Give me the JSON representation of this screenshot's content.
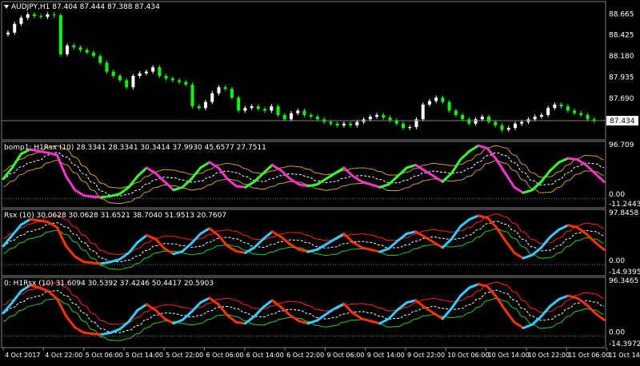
{
  "window": {
    "title": "AUDJPY,H1",
    "ohlc": "87.404 87.444 87.388 87.434"
  },
  "panels": [
    {
      "id": "price",
      "label": "",
      "axis_labels": [
        "88.665",
        "88.425",
        "88.180",
        "87.935",
        "87.690",
        "87.434"
      ],
      "current_price": "87.434"
    },
    {
      "id": "bomp",
      "label": "bomp1: H1Rsx (10) 28.3341 28.3341 30.3414 37.9930 45.6577 27.7511",
      "axis_labels": [
        "96.709",
        "0.00",
        "-11.2443"
      ]
    },
    {
      "id": "rsx",
      "label": "Rsx (10) 30.0628 30.0628 31.6521 38.7040 51.9513 20.7607",
      "axis_labels": [
        "97.8458",
        "0.00",
        "-14.9395"
      ]
    },
    {
      "id": "h1rsx",
      "label": "0: H1Rsx (10) 31.6094 30.5392 37.4246 50.4417 20.5903",
      "axis_labels": [
        "96.3465",
        "0.00",
        "-14.3972"
      ]
    }
  ],
  "time_axis": [
    "4 Oct 2017",
    "4 Oct 22:00",
    "5 Oct 06:00",
    "5 Oct 14:00",
    "5 Oct 22:00",
    "6 Oct 06:00",
    "6 Oct 14:00",
    "6 Oct 22:00",
    "9 Oct 06:00",
    "9 Oct 14:00",
    "9 Oct 22:00",
    "10 Oct 06:00",
    "10 Oct 14:00",
    "10 Oct 22:00",
    "11 Oct 06:00",
    "11 Oct 14:00"
  ],
  "colors": {
    "background": "#000000",
    "grid": "#7f7f7f",
    "candle_bull": "#ffffff",
    "candle_bear": "#00ff00",
    "bomp_up": "#33ff33",
    "bomp_down": "#ff33cc",
    "rsx_up": "#33ccff",
    "rsx_down": "#ff3300",
    "band_upper": "#ff2020",
    "band_lower": "#22cc22",
    "band_gold": "#d4a017",
    "dash_line": "#ffffff"
  },
  "chart_data": [
    {
      "type": "candlestick",
      "title": "AUDJPY,H1",
      "ylim": [
        87.25,
        88.77
      ],
      "series_close": [
        88.45,
        88.55,
        88.62,
        88.66,
        88.64,
        88.63,
        88.66,
        88.65,
        88.2,
        88.3,
        88.28,
        88.25,
        88.22,
        88.18,
        88.1,
        88.0,
        87.95,
        87.9,
        87.82,
        87.95,
        87.98,
        88.0,
        88.05,
        87.95,
        87.92,
        87.9,
        87.88,
        87.85,
        87.6,
        87.58,
        87.65,
        87.75,
        87.82,
        87.8,
        87.7,
        87.55,
        87.58,
        87.6,
        87.57,
        87.55,
        87.6,
        87.5,
        87.45,
        87.52,
        87.55,
        87.5,
        87.48,
        87.45,
        87.42,
        87.4,
        87.38,
        87.4,
        87.38,
        87.42,
        87.45,
        87.48,
        87.5,
        87.47,
        87.44,
        87.4,
        87.35,
        87.36,
        87.45,
        87.62,
        87.66,
        87.7,
        87.65,
        87.55,
        87.5,
        87.45,
        87.4,
        87.45,
        87.48,
        87.42,
        87.38,
        87.33,
        87.35,
        87.4,
        87.42,
        87.45,
        87.48,
        87.5,
        87.58,
        87.62,
        87.6,
        87.55,
        87.52,
        87.5,
        87.45,
        87.43
      ],
      "xlabel": "",
      "ylabel": ""
    },
    {
      "type": "line",
      "title": "bomp1: H1Rsx (10)",
      "ylim": [
        -11.2443,
        96.709
      ],
      "series": [
        {
          "values": [
            35,
            55,
            80,
            88,
            85,
            82,
            78,
            40,
            15,
            5,
            3,
            2,
            4,
            8,
            20,
            40,
            55,
            45,
            30,
            15,
            20,
            35,
            55,
            65,
            55,
            35,
            22,
            20,
            30,
            45,
            60,
            50,
            35,
            25,
            22,
            25,
            35,
            45,
            55,
            40,
            30,
            25,
            20,
            25,
            40,
            55,
            60,
            50,
            40,
            30,
            45,
            70,
            85,
            95,
            90,
            70,
            45,
            20,
            10,
            15,
            30,
            50,
            65,
            72,
            70,
            60,
            45,
            30
          ]
        }
      ]
    },
    {
      "type": "line",
      "title": "Rsx (10)",
      "ylim": [
        -14.9395,
        97.8458
      ],
      "series": [
        {
          "values": [
            35,
            55,
            75,
            85,
            83,
            80,
            70,
            35,
            15,
            5,
            3,
            2,
            5,
            10,
            22,
            42,
            55,
            48,
            30,
            20,
            25,
            40,
            58,
            68,
            55,
            35,
            25,
            22,
            32,
            48,
            62,
            52,
            38,
            28,
            24,
            28,
            38,
            48,
            58,
            42,
            32,
            28,
            24,
            30,
            45,
            58,
            62,
            52,
            42,
            32,
            48,
            72,
            85,
            92,
            88,
            70,
            45,
            22,
            12,
            18,
            32,
            52,
            66,
            74,
            70,
            58,
            42,
            28
          ]
        }
      ]
    },
    {
      "type": "line",
      "title": "0: H1Rsx (10)",
      "ylim": [
        -14.3972,
        96.3465
      ],
      "series": [
        {
          "values": [
            40,
            58,
            78,
            88,
            84,
            78,
            65,
            35,
            15,
            6,
            4,
            3,
            6,
            12,
            25,
            45,
            55,
            45,
            30,
            22,
            28,
            42,
            58,
            66,
            55,
            36,
            24,
            22,
            34,
            50,
            62,
            50,
            36,
            26,
            22,
            27,
            38,
            48,
            56,
            40,
            30,
            26,
            22,
            30,
            46,
            58,
            62,
            50,
            40,
            30,
            48,
            70,
            84,
            90,
            86,
            68,
            45,
            24,
            14,
            20,
            34,
            52,
            64,
            70,
            66,
            55,
            40,
            28
          ]
        }
      ]
    }
  ]
}
